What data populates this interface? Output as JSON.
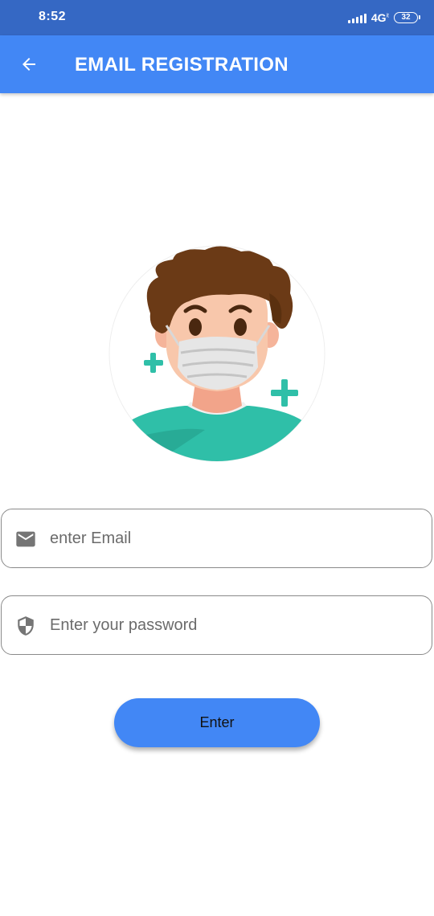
{
  "status_bar": {
    "time": "8:52",
    "network": "4G",
    "network_sub": "it",
    "battery": "32"
  },
  "app_bar": {
    "back_icon": "arrow-left-icon",
    "title": "EMAIL REGISTRATION"
  },
  "avatar": {
    "description_icon": "masked-person-avatar"
  },
  "form": {
    "email": {
      "icon": "mail-icon",
      "placeholder": "enter Email",
      "value": ""
    },
    "password": {
      "icon": "shield-icon",
      "placeholder": "Enter your password",
      "value": ""
    },
    "submit_label": "Enter"
  },
  "colors": {
    "status_bar": "#3568c4",
    "primary": "#4287f5",
    "field_border": "#8a8a8a",
    "icon_gray": "#757575",
    "teal": "#2fbfa8"
  }
}
